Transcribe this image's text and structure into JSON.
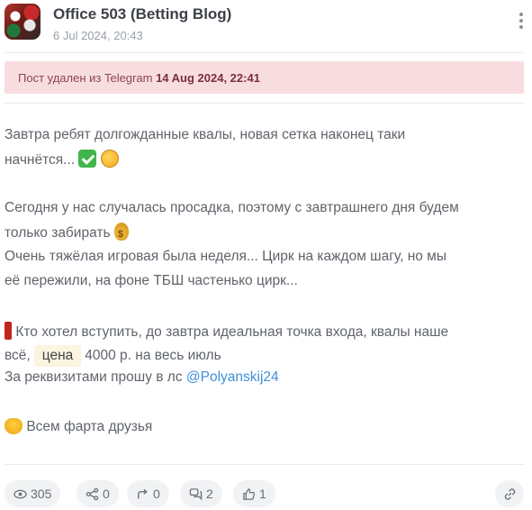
{
  "post": {
    "channel_name": "Office 503 (Betting Blog)",
    "date": "6 Jul 2024, 20:43"
  },
  "deleted_notice": {
    "prefix": "Пост удален из Telegram",
    "date": "14 Aug 2024, 22:41"
  },
  "body": {
    "line1": "Завтра ребят долгожданные квалы, новая сетка наконец таки",
    "line2": "начнётся...",
    "line3": "Сегодня у нас случалась просадка, поэтому с завтрашнего дня будем",
    "line4": "только забирать",
    "line5": "Очень тяжёлая игровая была неделя... Цирк на каждом шагу, но мы",
    "line6": "её пережили, на фоне ТБШ частенько цирк...",
    "line7": "Кто хотел вступить, до завтра идеальная точка входа, квалы наше",
    "line8_before": "всё,",
    "price_chip": "цена",
    "line8_after": "4000 р. на весь июль",
    "line9_before": "За реквизитами прошу в лс",
    "mention": "@Polyanskij24",
    "line10": "Всем фарта друзья"
  },
  "icons": {
    "check": "check-mark-emoji",
    "face": "face-emoji",
    "money": "money-bag-emoji",
    "exclamation": "red-exclamation-emoji",
    "heart": "yellow-heart-emoji"
  },
  "stats": {
    "views": "305",
    "shares": "0",
    "forwards": "0",
    "comments": "2",
    "reactions": "1"
  }
}
